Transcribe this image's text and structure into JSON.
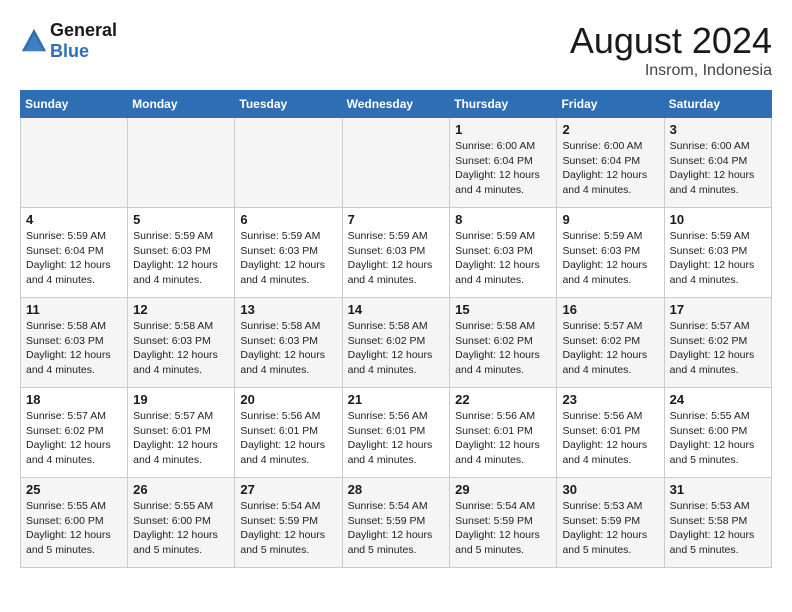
{
  "header": {
    "logo_line1": "General",
    "logo_line2": "Blue",
    "month_title": "August 2024",
    "location": "Insrom, Indonesia"
  },
  "weekdays": [
    "Sunday",
    "Monday",
    "Tuesday",
    "Wednesday",
    "Thursday",
    "Friday",
    "Saturday"
  ],
  "weeks": [
    [
      {
        "day": "",
        "info": ""
      },
      {
        "day": "",
        "info": ""
      },
      {
        "day": "",
        "info": ""
      },
      {
        "day": "",
        "info": ""
      },
      {
        "day": "1",
        "info": "Sunrise: 6:00 AM\nSunset: 6:04 PM\nDaylight: 12 hours and 4 minutes."
      },
      {
        "day": "2",
        "info": "Sunrise: 6:00 AM\nSunset: 6:04 PM\nDaylight: 12 hours and 4 minutes."
      },
      {
        "day": "3",
        "info": "Sunrise: 6:00 AM\nSunset: 6:04 PM\nDaylight: 12 hours and 4 minutes."
      }
    ],
    [
      {
        "day": "4",
        "info": "Sunrise: 5:59 AM\nSunset: 6:04 PM\nDaylight: 12 hours and 4 minutes."
      },
      {
        "day": "5",
        "info": "Sunrise: 5:59 AM\nSunset: 6:03 PM\nDaylight: 12 hours and 4 minutes."
      },
      {
        "day": "6",
        "info": "Sunrise: 5:59 AM\nSunset: 6:03 PM\nDaylight: 12 hours and 4 minutes."
      },
      {
        "day": "7",
        "info": "Sunrise: 5:59 AM\nSunset: 6:03 PM\nDaylight: 12 hours and 4 minutes."
      },
      {
        "day": "8",
        "info": "Sunrise: 5:59 AM\nSunset: 6:03 PM\nDaylight: 12 hours and 4 minutes."
      },
      {
        "day": "9",
        "info": "Sunrise: 5:59 AM\nSunset: 6:03 PM\nDaylight: 12 hours and 4 minutes."
      },
      {
        "day": "10",
        "info": "Sunrise: 5:59 AM\nSunset: 6:03 PM\nDaylight: 12 hours and 4 minutes."
      }
    ],
    [
      {
        "day": "11",
        "info": "Sunrise: 5:58 AM\nSunset: 6:03 PM\nDaylight: 12 hours and 4 minutes."
      },
      {
        "day": "12",
        "info": "Sunrise: 5:58 AM\nSunset: 6:03 PM\nDaylight: 12 hours and 4 minutes."
      },
      {
        "day": "13",
        "info": "Sunrise: 5:58 AM\nSunset: 6:03 PM\nDaylight: 12 hours and 4 minutes."
      },
      {
        "day": "14",
        "info": "Sunrise: 5:58 AM\nSunset: 6:02 PM\nDaylight: 12 hours and 4 minutes."
      },
      {
        "day": "15",
        "info": "Sunrise: 5:58 AM\nSunset: 6:02 PM\nDaylight: 12 hours and 4 minutes."
      },
      {
        "day": "16",
        "info": "Sunrise: 5:57 AM\nSunset: 6:02 PM\nDaylight: 12 hours and 4 minutes."
      },
      {
        "day": "17",
        "info": "Sunrise: 5:57 AM\nSunset: 6:02 PM\nDaylight: 12 hours and 4 minutes."
      }
    ],
    [
      {
        "day": "18",
        "info": "Sunrise: 5:57 AM\nSunset: 6:02 PM\nDaylight: 12 hours and 4 minutes."
      },
      {
        "day": "19",
        "info": "Sunrise: 5:57 AM\nSunset: 6:01 PM\nDaylight: 12 hours and 4 minutes."
      },
      {
        "day": "20",
        "info": "Sunrise: 5:56 AM\nSunset: 6:01 PM\nDaylight: 12 hours and 4 minutes."
      },
      {
        "day": "21",
        "info": "Sunrise: 5:56 AM\nSunset: 6:01 PM\nDaylight: 12 hours and 4 minutes."
      },
      {
        "day": "22",
        "info": "Sunrise: 5:56 AM\nSunset: 6:01 PM\nDaylight: 12 hours and 4 minutes."
      },
      {
        "day": "23",
        "info": "Sunrise: 5:56 AM\nSunset: 6:01 PM\nDaylight: 12 hours and 4 minutes."
      },
      {
        "day": "24",
        "info": "Sunrise: 5:55 AM\nSunset: 6:00 PM\nDaylight: 12 hours and 5 minutes."
      }
    ],
    [
      {
        "day": "25",
        "info": "Sunrise: 5:55 AM\nSunset: 6:00 PM\nDaylight: 12 hours and 5 minutes."
      },
      {
        "day": "26",
        "info": "Sunrise: 5:55 AM\nSunset: 6:00 PM\nDaylight: 12 hours and 5 minutes."
      },
      {
        "day": "27",
        "info": "Sunrise: 5:54 AM\nSunset: 5:59 PM\nDaylight: 12 hours and 5 minutes."
      },
      {
        "day": "28",
        "info": "Sunrise: 5:54 AM\nSunset: 5:59 PM\nDaylight: 12 hours and 5 minutes."
      },
      {
        "day": "29",
        "info": "Sunrise: 5:54 AM\nSunset: 5:59 PM\nDaylight: 12 hours and 5 minutes."
      },
      {
        "day": "30",
        "info": "Sunrise: 5:53 AM\nSunset: 5:59 PM\nDaylight: 12 hours and 5 minutes."
      },
      {
        "day": "31",
        "info": "Sunrise: 5:53 AM\nSunset: 5:58 PM\nDaylight: 12 hours and 5 minutes."
      }
    ]
  ]
}
